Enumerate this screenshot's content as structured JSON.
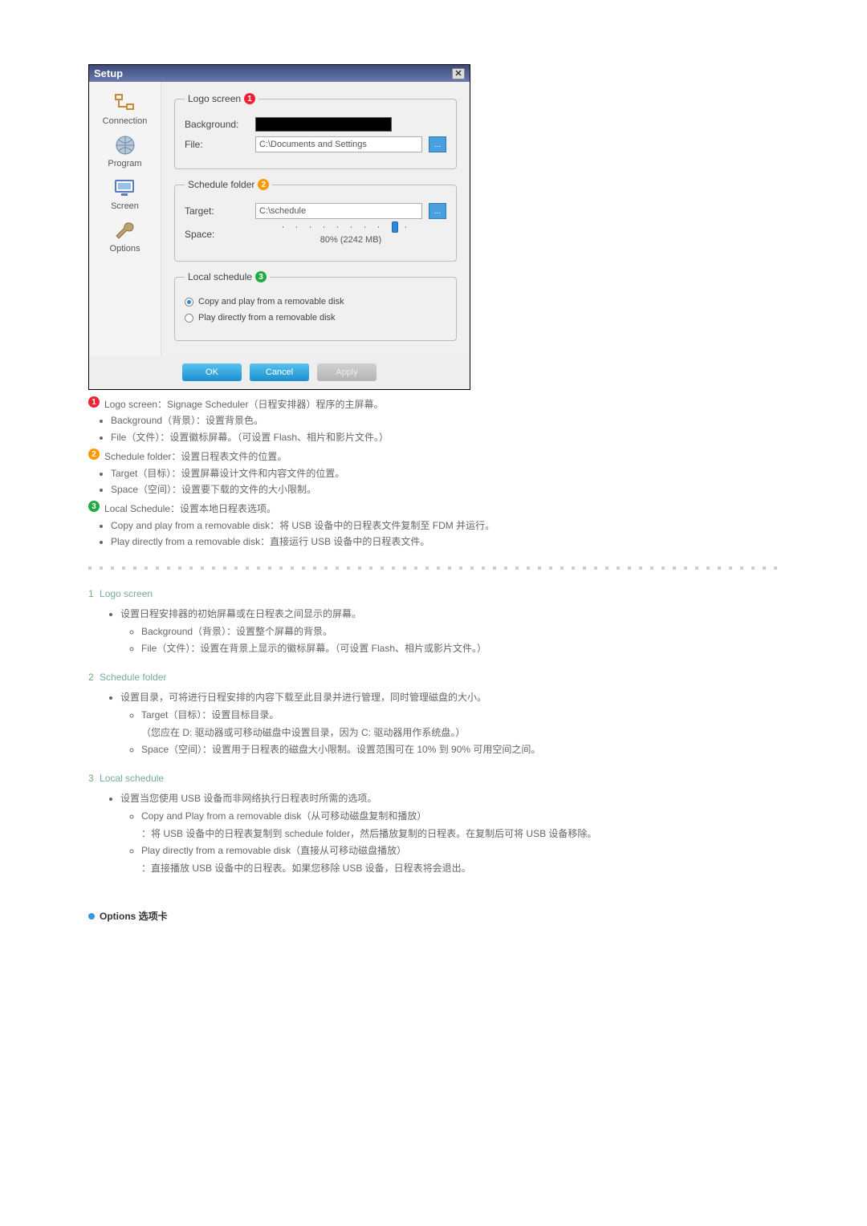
{
  "dialog": {
    "title": "Setup",
    "sidebar": {
      "connection": "Connection",
      "program": "Program",
      "screen": "Screen",
      "options": "Options"
    },
    "logoscreen": {
      "legend": "Logo screen",
      "background_label": "Background:",
      "file_label": "File:",
      "file_value": "C:\\Documents and Settings"
    },
    "schedulefolder": {
      "legend": "Schedule folder",
      "target_label": "Target:",
      "target_value": "C:\\schedule",
      "space_label": "Space:",
      "space_value": "80% (2242 MB)"
    },
    "localschedule": {
      "legend": "Local schedule",
      "opt_copy": "Copy and play from a removable disk",
      "opt_play": "Play directly from a removable disk"
    },
    "buttons": {
      "ok": "OK",
      "cancel": "Cancel",
      "apply": "Apply"
    }
  },
  "notes": {
    "n1_title": "Logo screen：Signage Scheduler（日程安排器）程序的主屏幕。",
    "n1_a": "Background（背景）：设置背景色。",
    "n1_b": "File（文件）：设置徽标屏幕。（可设置 Flash、相片和影片文件。）",
    "n2_title": "Schedule folder：设置日程表文件的位置。",
    "n2_a": "Target（目标）：设置屏幕设计文件和内容文件的位置。",
    "n2_b": "Space（空间）：设置要下载的文件的大小限制。",
    "n3_title": "Local Schedule：设置本地日程表选项。",
    "n3_a": "Copy and play from a removable disk：将 USB 设备中的日程表文件复制至 FDM 并运行。",
    "n3_b": "Play directly from a removable disk：直接运行 USB 设备中的日程表文件。"
  },
  "detail": {
    "s1": {
      "num": "1",
      "title": "Logo screen",
      "b1": "设置日程安排器的初始屏幕或在日程表之间显示的屏幕。",
      "b1a": "Background（背景）：设置整个屏幕的背景。",
      "b1b": "File（文件）：设置在背景上显示的徽标屏幕。（可设置 Flash、相片或影片文件。）"
    },
    "s2": {
      "num": "2",
      "title": "Schedule folder",
      "b1": "设置目录，可将进行日程安排的内容下载至此目录并进行管理，同时管理磁盘的大小。",
      "b1a": "Target（目标）：设置目标目录。",
      "b1a_note": "（您应在 D: 驱动器或可移动磁盘中设置目录，因为 C: 驱动器用作系统盘。）",
      "b1b": "Space（空间）：设置用于日程表的磁盘大小限制。设置范围可在 10% 到 90% 可用空间之间。"
    },
    "s3": {
      "num": "3",
      "title": "Local schedule",
      "b1": "设置当您使用 USB 设备而非网络执行日程表时所需的选项。",
      "b1a": "Copy and Play from a removable disk（从可移动磁盘复制和播放）",
      "b1a_note": "：将 USB 设备中的日程表复制到 schedule folder，然后播放复制的日程表。在复制后可将 USB 设备移除。",
      "b1b": "Play directly from a removable disk（直接从可移动磁盘播放）",
      "b1b_note": "：直接播放 USB 设备中的日程表。如果您移除 USB 设备，日程表将会退出。"
    }
  },
  "options_tab": {
    "label": "Options 选项卡"
  }
}
